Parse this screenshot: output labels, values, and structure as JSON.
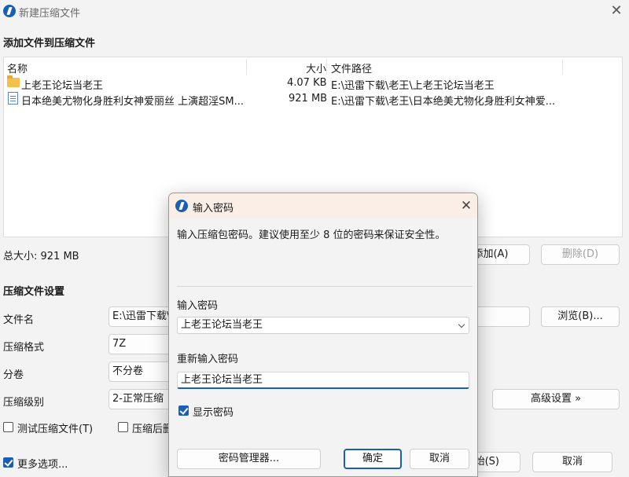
{
  "main_window": {
    "title": "新建压缩文件",
    "close_glyph": "✕",
    "add_section_title": "添加文件到压缩文件",
    "columns": {
      "name": "名称",
      "size": "大小",
      "path": "文件路径"
    },
    "files": [
      {
        "icon": "folder-icon",
        "name": "上老王论坛当老王",
        "size": "4.07 KB",
        "path": "E:\\迅雷下载\\老王\\上老王论坛当老王"
      },
      {
        "icon": "document-icon",
        "name": "日本绝美尤物化身胜利女神爱丽丝 上演超淫SM...",
        "size": "921 MB",
        "path": "E:\\迅雷下载\\老王\\日本绝美尤物化身胜利女神爱..."
      }
    ],
    "total_size": "总大小: 921 MB",
    "add_button": "添加(A)",
    "delete_button": "删除(D)",
    "settings_section_title": "压缩文件设置",
    "filename_label": "文件名",
    "filename_value": "E:\\迅雷下载\\",
    "browse_button": "浏览(B)...",
    "format_label": "压缩格式",
    "format_value": "7Z",
    "volume_label": "分卷",
    "volume_value": "不分卷",
    "level_label": "压缩级别",
    "level_value": "2-正常压缩",
    "advanced_button": "高级设置 »",
    "test_checkbox_label": "测试压缩文件(T)",
    "test_checked": false,
    "after_checkbox_label": "压缩后删",
    "after_checked": false,
    "more_options_label": "更多选项...",
    "more_checked": true,
    "start_button": "始(S)",
    "cancel_button": "取消"
  },
  "password_dialog": {
    "title": "输入密码",
    "close_glyph": "✕",
    "description": "输入压缩包密码。建议使用至少 8 位的密码来保证安全性。",
    "password_label": "输入密码",
    "password_value": "上老王论坛当老王",
    "reenter_label": "重新输入密码",
    "reenter_value": "上老王论坛当老王",
    "show_password_label": "显示密码",
    "show_password_checked": true,
    "manager_button": "密码管理器...",
    "ok_button": "确定",
    "cancel_button": "取消"
  },
  "colors": {
    "accent": "#1a5fb4",
    "dialog_title_bg": "#fbeee6",
    "window_bg": "#f3f3f3"
  }
}
